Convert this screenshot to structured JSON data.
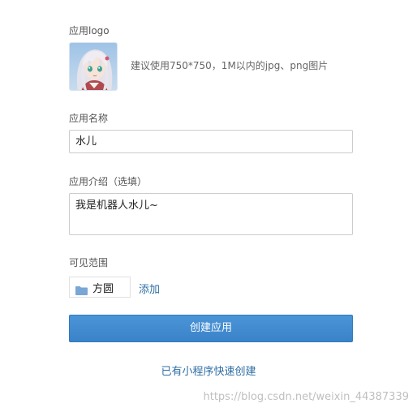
{
  "form": {
    "logo": {
      "label": "应用logo",
      "hint": "建议使用750*750，1M以内的jpg、png图片"
    },
    "name": {
      "label": "应用名称",
      "value": "水儿"
    },
    "intro": {
      "label": "应用介绍（选填）",
      "value": "我是机器人水儿~"
    },
    "scope": {
      "label": "可见范围",
      "chip": "方圆",
      "add": "添加"
    },
    "submit_label": "创建应用",
    "mini_program_link": "已有小程序快速创建"
  },
  "watermark": "https://blog.csdn.net/weixin_44387339",
  "colors": {
    "primary_button": "#3b83c8",
    "link": "#2e6da4",
    "folder_icon": "#7aa6d6"
  }
}
